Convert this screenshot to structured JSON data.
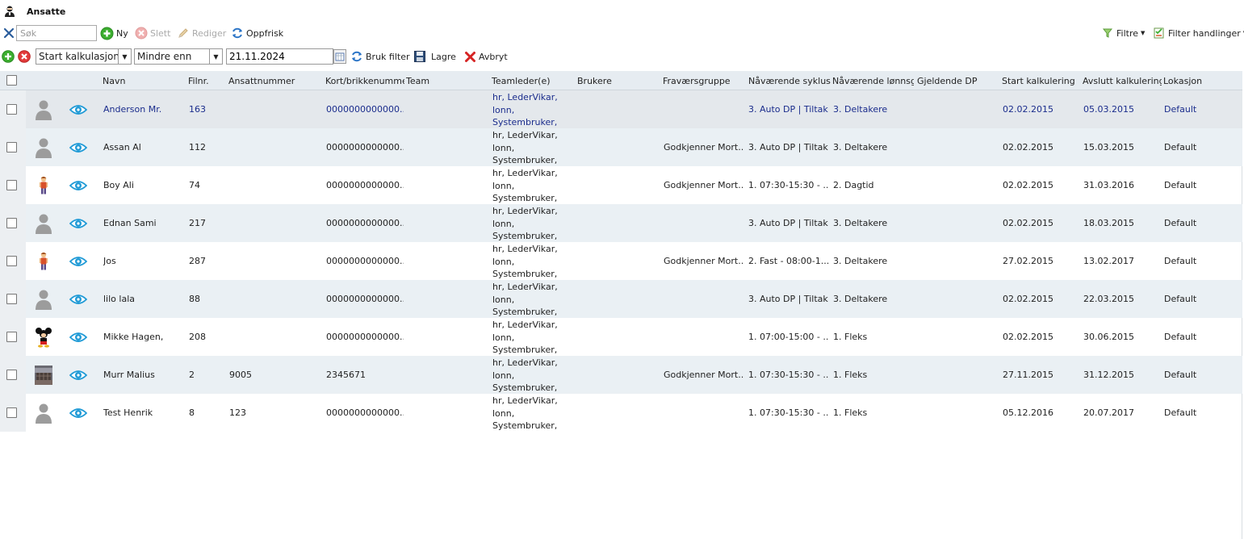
{
  "title": "Ansatte",
  "toolbar": {
    "search_placeholder": "Søk",
    "new_label": "Ny",
    "delete_label": "Slett",
    "edit_label": "Rediger",
    "refresh_label": "Oppfrisk",
    "filters_label": "Filtre",
    "filter_actions_label": "Filter handlinger"
  },
  "filterbar": {
    "field_value": "Start kalkulasjon",
    "operator_value": "Mindre enn",
    "date_value": "21.11.2024",
    "apply_label": "Bruk filter",
    "save_label": "Lagre",
    "cancel_label": "Avbryt"
  },
  "columns": {
    "navn": "Navn",
    "filnr": "Filnr.",
    "ansattnummer": "Ansattnummer",
    "kort": "Kort/brikkenummer",
    "team": "Team",
    "teamleder": "Teamleder(e)",
    "brukere": "Brukere",
    "fravaersgruppe": "Fraværsgruppe",
    "syklus": "Nåværende syklus",
    "lonnsgruppe": "Nåværende lønnsgru",
    "gjeldende_dp": "Gjeldende DP",
    "start_kalk": "Start kalkulering",
    "avslutt_kalk": "Avslutt kalkulering",
    "lokasjon": "Lokasjon"
  },
  "rows": [
    {
      "avatar": "person-icon",
      "navn": "Anderson Mr.",
      "filnr": "163",
      "ansattnummer": "",
      "kort": "0000000000000...",
      "team": "",
      "teamleder": [
        "hr, LederVikar,",
        "lonn,",
        "Systembruker,"
      ],
      "brukere": "",
      "fravaersgruppe": "",
      "syklus": "3. Auto DP | Tiltak",
      "lonnsgruppe": "3. Deltakere",
      "gjeldende_dp": "",
      "start_kalk": "02.02.2015",
      "avslutt_kalk": "05.03.2015",
      "lokasjon": "Default"
    },
    {
      "avatar": "person-icon",
      "navn": "Assan Al",
      "filnr": "112",
      "ansattnummer": "",
      "kort": "0000000000000...",
      "team": "",
      "teamleder": [
        "hr, LederVikar,",
        "lonn,",
        "Systembruker,"
      ],
      "brukere": "",
      "fravaersgruppe": "Godkjenner Mort...",
      "syklus": "3. Auto DP | Tiltak",
      "lonnsgruppe": "3. Deltakere",
      "gjeldende_dp": "",
      "start_kalk": "02.02.2015",
      "avslutt_kalk": "15.03.2015",
      "lokasjon": "Default"
    },
    {
      "avatar": "boy-figure-icon",
      "navn": "Boy Ali",
      "filnr": "74",
      "ansattnummer": "",
      "kort": "0000000000000...",
      "team": "",
      "teamleder": [
        "hr, LederVikar,",
        "lonn,",
        "Systembruker,"
      ],
      "brukere": "",
      "fravaersgruppe": "Godkjenner Mort...",
      "syklus": "1. 07:30-15:30 - ...",
      "lonnsgruppe": "2. Dagtid",
      "gjeldende_dp": "",
      "start_kalk": "02.02.2015",
      "avslutt_kalk": "31.03.2016",
      "lokasjon": "Default"
    },
    {
      "avatar": "person-icon",
      "navn": "Ednan Sami",
      "filnr": "217",
      "ansattnummer": "",
      "kort": "0000000000000...",
      "team": "",
      "teamleder": [
        "hr, LederVikar,",
        "lonn,",
        "Systembruker,"
      ],
      "brukere": "",
      "fravaersgruppe": "",
      "syklus": "3. Auto DP | Tiltak",
      "lonnsgruppe": "3. Deltakere",
      "gjeldende_dp": "",
      "start_kalk": "02.02.2015",
      "avslutt_kalk": "18.03.2015",
      "lokasjon": "Default"
    },
    {
      "avatar": "boy-figure-icon",
      "navn": "Jos",
      "filnr": "287",
      "ansattnummer": "",
      "kort": "0000000000000...",
      "team": "",
      "teamleder": [
        "hr, LederVikar,",
        "lonn,",
        "Systembruker,"
      ],
      "brukere": "",
      "fravaersgruppe": "Godkjenner Mort...",
      "syklus": "2. Fast - 08:00-1...",
      "lonnsgruppe": "3. Deltakere",
      "gjeldende_dp": "",
      "start_kalk": "27.02.2015",
      "avslutt_kalk": "13.02.2017",
      "lokasjon": "Default"
    },
    {
      "avatar": "person-icon",
      "navn": "lilo lala",
      "filnr": "88",
      "ansattnummer": "",
      "kort": "0000000000000...",
      "team": "",
      "teamleder": [
        "hr, LederVikar,",
        "lonn,",
        "Systembruker,"
      ],
      "brukere": "",
      "fravaersgruppe": "",
      "syklus": "3. Auto DP | Tiltak",
      "lonnsgruppe": "3. Deltakere",
      "gjeldende_dp": "",
      "start_kalk": "02.02.2015",
      "avslutt_kalk": "22.03.2015",
      "lokasjon": "Default"
    },
    {
      "avatar": "mouse-cartoon-icon",
      "navn": "Mikke Hagen,",
      "filnr": "208",
      "ansattnummer": "",
      "kort": "0000000000000...",
      "team": "",
      "teamleder": [
        "hr, LederVikar,",
        "lonn,",
        "Systembruker,"
      ],
      "brukere": "",
      "fravaersgruppe": "",
      "syklus": "1. 07:00-15:00 - ...",
      "lonnsgruppe": "1. Fleks",
      "gjeldende_dp": "",
      "start_kalk": "02.02.2015",
      "avslutt_kalk": "30.06.2015",
      "lokasjon": "Default"
    },
    {
      "avatar": "photo-icon",
      "navn": "Murr Malius",
      "filnr": "2",
      "ansattnummer": "9005",
      "kort": "2345671",
      "team": "",
      "teamleder": [
        "hr, LederVikar,",
        "lonn,",
        "Systembruker,"
      ],
      "brukere": "",
      "fravaersgruppe": "Godkjenner Mort...",
      "syklus": "1. 07:30-15:30 - ...",
      "lonnsgruppe": "1. Fleks",
      "gjeldende_dp": "",
      "start_kalk": "27.11.2015",
      "avslutt_kalk": "31.12.2015",
      "lokasjon": "Default"
    },
    {
      "avatar": "person-icon",
      "navn": "Test Henrik",
      "filnr": "8",
      "ansattnummer": "123",
      "kort": "0000000000000...",
      "team": "",
      "teamleder": [
        "hr, LederVikar,",
        "lonn,",
        "Systembruker,"
      ],
      "brukere": "",
      "fravaersgruppe": "",
      "syklus": "1. 07:30-15:30 - ...",
      "lonnsgruppe": "1. Fleks",
      "gjeldende_dp": "",
      "start_kalk": "05.12.2016",
      "avslutt_kalk": "20.07.2017",
      "lokasjon": "Default"
    }
  ],
  "colors": {
    "header_bg": "#e6ecf1",
    "alt_row_bg": "#eaf0f4",
    "selected_text": "#1a2c8c",
    "eye_icon": "#1f9ad6"
  }
}
